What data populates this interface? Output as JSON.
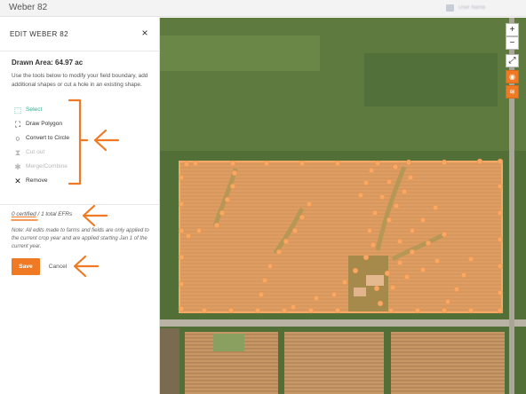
{
  "window": {
    "title": "Weber 82"
  },
  "user": {
    "name_blurred": "User Name"
  },
  "panel": {
    "title": "EDIT WEBER 82",
    "close_label": "×",
    "drawn_area": "Drawn Area: 64.97 ac",
    "description": "Use the tools below to modify your field boundary, add additional shapes or cut a hole in an existing shape.",
    "tools": [
      {
        "label": "Select",
        "icon": "cursor-select-icon",
        "glyph": "⬚",
        "state": "active"
      },
      {
        "label": "Draw Polygon",
        "icon": "polygon-icon",
        "glyph": "⛶",
        "state": "normal"
      },
      {
        "label": "Convert to Circle",
        "icon": "circle-icon",
        "glyph": "○",
        "state": "normal"
      },
      {
        "label": "Cut out",
        "icon": "cut-out-icon",
        "glyph": "⧗",
        "state": "disabled"
      },
      {
        "label": "Merge/Combine",
        "icon": "merge-icon",
        "glyph": "✱",
        "state": "disabled"
      },
      {
        "label": "Remove",
        "icon": "remove-icon",
        "glyph": "✕",
        "state": "normal"
      }
    ],
    "certified": "0 certified",
    "separator": "/",
    "total_efrs": "1 total EFRs",
    "note": "Note: All edits made to farms and fields are only applied to the current crop year and are applied starting Jan 1 of the current year.",
    "save_label": "Save",
    "cancel_label": "Cancel"
  },
  "map": {
    "controls": [
      {
        "name": "zoom-in-button",
        "glyph": "+"
      },
      {
        "name": "zoom-out-button",
        "glyph": "−"
      },
      {
        "name": "fullscreen-button",
        "glyph": "⤢"
      },
      {
        "name": "globe-layer-button",
        "glyph": "◉"
      },
      {
        "name": "layers-button",
        "glyph": "≋"
      }
    ]
  },
  "colors": {
    "accent": "#ef7a23",
    "active_tool": "#2fae8e",
    "field_fill": "#f0a35e",
    "vertex": "#f7a864"
  }
}
